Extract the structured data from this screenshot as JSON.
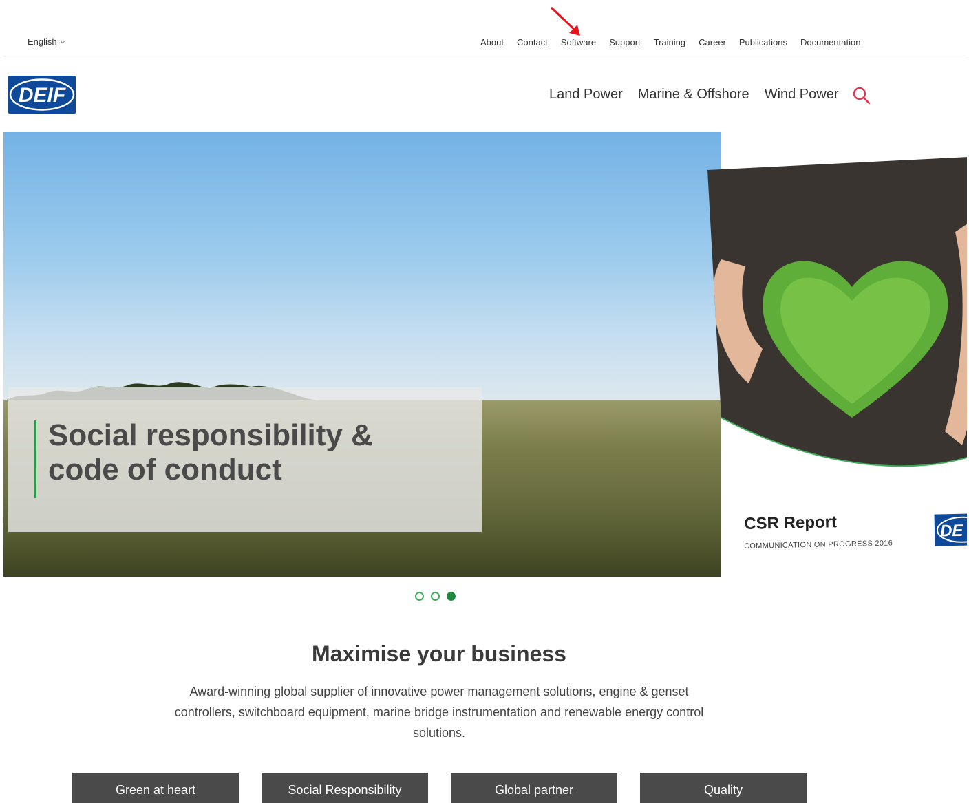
{
  "utility_bar": {
    "language": "English",
    "links": [
      "About",
      "Contact",
      "Software",
      "Support",
      "Training",
      "Career",
      "Publications",
      "Documentation"
    ]
  },
  "header": {
    "logo_text": "DEIF",
    "nav": [
      "Land Power",
      "Marine & Offshore",
      "Wind Power"
    ],
    "search_icon": "search-icon"
  },
  "hero": {
    "caption_line1": "Social responsibility &",
    "caption_line2": "code of conduct",
    "csr_title": "CSR Report",
    "csr_subtitle": "COMMUNICATION ON PROGRESS 2016",
    "csr_logo_text": "DE",
    "slide_count": 3,
    "active_slide": 3
  },
  "intro": {
    "title": "Maximise your business",
    "text": "Award-winning global supplier of innovative power management solutions, engine & genset controllers, switchboard equipment, marine bridge instrumentation and renewable energy control solutions."
  },
  "cta_buttons": [
    "Green at heart",
    "Social Responsibility",
    "Global partner",
    "Quality"
  ],
  "colors": {
    "brand_blue": "#0e4a99",
    "accent_green": "#2e9a48",
    "search_red": "#e0354f",
    "annotation_arrow": "#e8141c",
    "button_dark": "#4a4a4a"
  }
}
